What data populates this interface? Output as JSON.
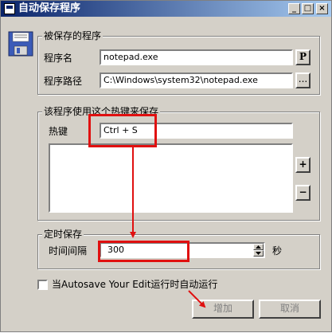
{
  "window": {
    "title": "自动保存程序",
    "controls": [
      "_",
      "□",
      "×"
    ]
  },
  "program_group": {
    "title": "被保存的程序",
    "name_label": "程序名",
    "name_value": "notepad.exe",
    "path_label": "程序路径",
    "path_value": "C:\\Windows\\system32\\notepad.exe",
    "p_button": "P",
    "browse_button": "..."
  },
  "hotkey_group": {
    "title": "该程序使用这个热键来保存",
    "hotkey_label": "热键",
    "hotkey_value": "Ctrl + S",
    "add_button": "+",
    "remove_button": "−"
  },
  "timer_group": {
    "title": "定时保存",
    "interval_label": "时间间隔",
    "interval_value": "300",
    "unit": "秒"
  },
  "autorun": {
    "label": "当Autosave Your Edit运行时自动运行",
    "checked": false
  },
  "footer": {
    "add_label": "增加",
    "cancel_label": "取消"
  },
  "colors": {
    "highlight": "#e01010",
    "titlebar_start": "#0a246a",
    "titlebar_end": "#a6caf0"
  }
}
